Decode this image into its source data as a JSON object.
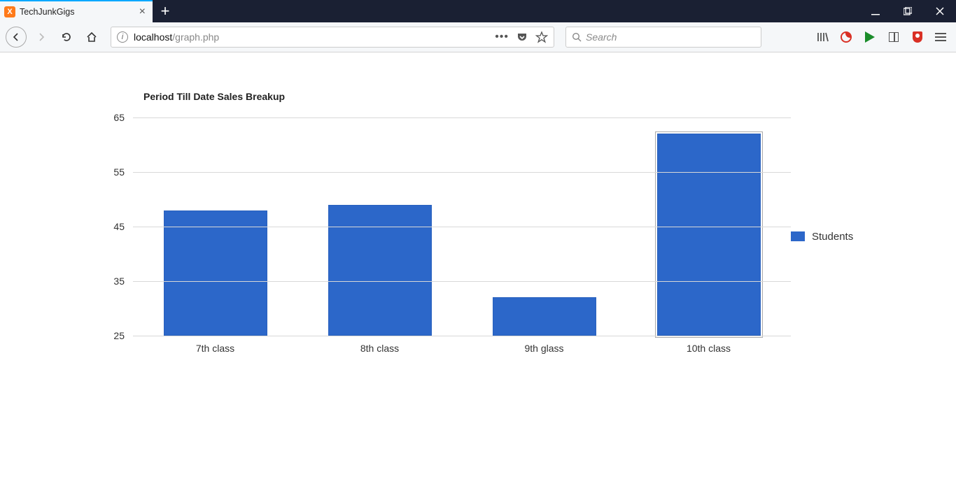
{
  "browser": {
    "tab_title": "TechJunkGigs",
    "url_display": {
      "before_host": "",
      "host": "localhost",
      "path": "/graph.php"
    },
    "search_placeholder": "Search"
  },
  "chart_data": {
    "type": "bar",
    "title": "Period Till Date Sales Breakup",
    "legend": "Students",
    "ylim": [
      25,
      65
    ],
    "yticks": [
      25,
      35,
      45,
      55,
      65
    ],
    "categories": [
      "7th class",
      "8th class",
      "9th glass",
      "10th class"
    ],
    "values": [
      48,
      49,
      32,
      62
    ],
    "xlabel": "",
    "ylabel": ""
  }
}
